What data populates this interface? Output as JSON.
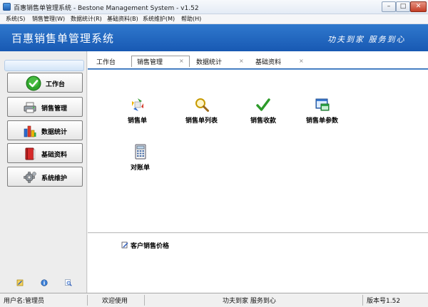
{
  "window": {
    "title": "百惠销售单管理系统 - Bestone Management System - v1.52",
    "minimize": "–",
    "maximize": "□",
    "close": "✕"
  },
  "menu": [
    "系统(S)",
    "销售管理(W)",
    "数据统计(R)",
    "基础资料(B)",
    "系统维护(M)",
    "帮助(H)"
  ],
  "header": {
    "title": "百惠销售单管理系统",
    "slogan": "功夫到家 服务到心"
  },
  "sidebar": {
    "items": [
      {
        "label": "工作台",
        "icon": "check-circle-icon"
      },
      {
        "label": "销售管理",
        "icon": "printer-icon"
      },
      {
        "label": "数据统计",
        "icon": "bar-chart-icon"
      },
      {
        "label": "基础资料",
        "icon": "book-icon"
      },
      {
        "label": "系统维护",
        "icon": "gear-icon"
      }
    ],
    "tools": [
      "edit-icon",
      "info-icon",
      "search-icon"
    ]
  },
  "tabs": [
    {
      "label": "工作台",
      "closable": false
    },
    {
      "label": "销售管理",
      "closable": true,
      "active": true
    },
    {
      "label": "数据统计",
      "closable": true
    },
    {
      "label": "基础资料",
      "closable": true
    }
  ],
  "tab_close_glyph": "×",
  "functions": [
    {
      "label": "销售单",
      "icon": "sales-order-icon"
    },
    {
      "label": "销售单列表",
      "icon": "magnifier-icon"
    },
    {
      "label": "销售收款",
      "icon": "checkmark-icon"
    },
    {
      "label": "销售单参数",
      "icon": "window-settings-icon"
    },
    {
      "label": "对账单",
      "icon": "calculator-icon"
    }
  ],
  "links": [
    {
      "label": "客户销售价格",
      "icon": "edit-icon"
    }
  ],
  "status": {
    "user": "用户名:管理员",
    "welcome": "欢迎使用",
    "slogan": "功夫到家 服务到心",
    "version": "版本号1.52"
  },
  "colors": {
    "header": "#2466c0",
    "tab_underline": "#1f5fb0"
  }
}
